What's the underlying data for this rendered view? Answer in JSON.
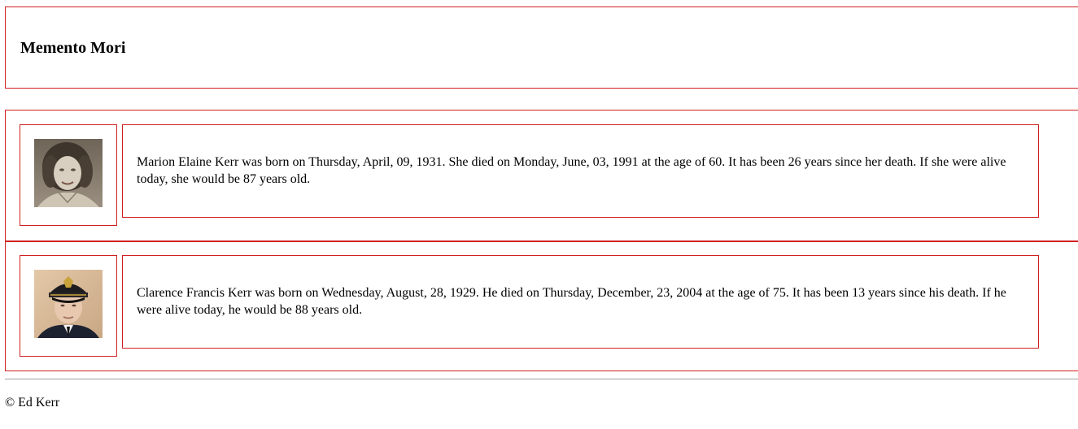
{
  "header": {
    "title": "Memento Mori"
  },
  "people": [
    {
      "photo_icon": "portrait-woman",
      "bio": "Marion Elaine Kerr was born on Thursday, April, 09, 1931. She died on Monday, June, 03, 1991 at the age of 60. It has been 26 years since her death. If she were alive today, she would be 87 years old."
    },
    {
      "photo_icon": "portrait-man-in-uniform",
      "bio": "Clarence Francis Kerr was born on Wednesday, August, 28, 1929. He died on Thursday, December, 23, 2004 at the age of 75. It has been 13 years since his death. If he were alive today, he would be 88 years old."
    }
  ],
  "footer": {
    "copyright": "© Ed Kerr"
  },
  "colors": {
    "border": "#d02020",
    "rule": "#a0a0a0"
  }
}
